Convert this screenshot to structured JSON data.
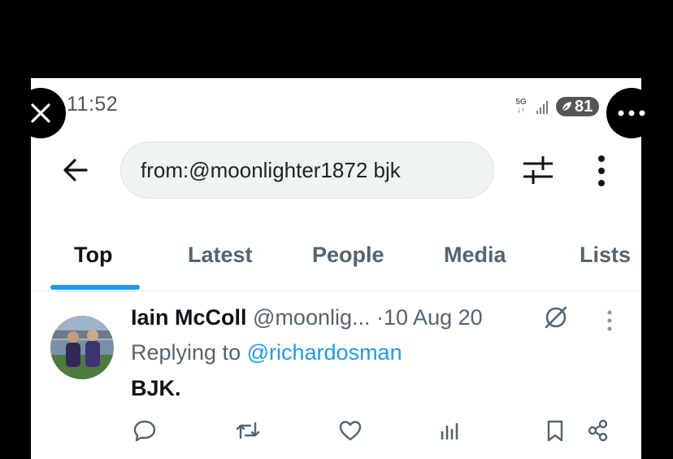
{
  "status_bar": {
    "time": "11:52",
    "network": "5G",
    "network_arrows": "↓↑",
    "battery": "81"
  },
  "search": {
    "query": "from:@moonlighter1872 bjk"
  },
  "tabs": [
    {
      "label": "Top",
      "active": true
    },
    {
      "label": "Latest",
      "active": false
    },
    {
      "label": "People",
      "active": false
    },
    {
      "label": "Media",
      "active": false
    },
    {
      "label": "Lists",
      "active": false
    }
  ],
  "tweet": {
    "display_name": "Iain McColl",
    "handle": "@moonlig...",
    "separator": "·",
    "date": "10 Aug 20",
    "replying_prefix": "Replying to",
    "replying_to": "@richardosman",
    "text": "BJK."
  },
  "colors": {
    "accent": "#1d9bf0",
    "text_primary": "#0f1419",
    "text_secondary": "#536471",
    "search_bg": "#eff3f4"
  },
  "icons": {
    "close": "close-icon",
    "more": "more-horizontal-icon",
    "back": "arrow-left-icon",
    "filter": "sliders-icon",
    "kebab": "more-vertical-icon",
    "grok": "grok-icon",
    "actions": [
      "reply-icon",
      "retweet-icon",
      "like-icon",
      "views-icon",
      "bookmark-icon",
      "share-icon"
    ]
  }
}
